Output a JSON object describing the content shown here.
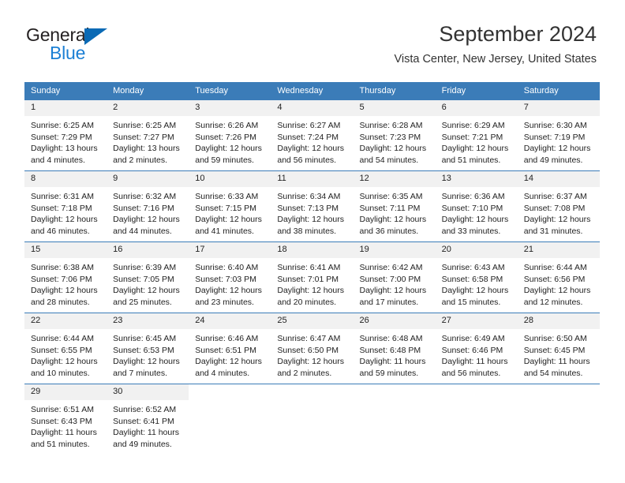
{
  "brand": {
    "line1": "General",
    "line2": "Blue",
    "triangle_color": "#0a6ab5",
    "line2_color": "#1b7fd4"
  },
  "header": {
    "title": "September 2024",
    "subtitle": "Vista Center, New Jersey, United States",
    "accent_color": "#3b7cb8",
    "daynum_background": "#f1f1f1"
  },
  "weekday_headers": [
    "Sunday",
    "Monday",
    "Tuesday",
    "Wednesday",
    "Thursday",
    "Friday",
    "Saturday"
  ],
  "weeks": [
    [
      {
        "day": "1",
        "sunrise": "Sunrise: 6:25 AM",
        "sunset": "Sunset: 7:29 PM",
        "daylight1": "Daylight: 13 hours",
        "daylight2": "and 4 minutes."
      },
      {
        "day": "2",
        "sunrise": "Sunrise: 6:25 AM",
        "sunset": "Sunset: 7:27 PM",
        "daylight1": "Daylight: 13 hours",
        "daylight2": "and 2 minutes."
      },
      {
        "day": "3",
        "sunrise": "Sunrise: 6:26 AM",
        "sunset": "Sunset: 7:26 PM",
        "daylight1": "Daylight: 12 hours",
        "daylight2": "and 59 minutes."
      },
      {
        "day": "4",
        "sunrise": "Sunrise: 6:27 AM",
        "sunset": "Sunset: 7:24 PM",
        "daylight1": "Daylight: 12 hours",
        "daylight2": "and 56 minutes."
      },
      {
        "day": "5",
        "sunrise": "Sunrise: 6:28 AM",
        "sunset": "Sunset: 7:23 PM",
        "daylight1": "Daylight: 12 hours",
        "daylight2": "and 54 minutes."
      },
      {
        "day": "6",
        "sunrise": "Sunrise: 6:29 AM",
        "sunset": "Sunset: 7:21 PM",
        "daylight1": "Daylight: 12 hours",
        "daylight2": "and 51 minutes."
      },
      {
        "day": "7",
        "sunrise": "Sunrise: 6:30 AM",
        "sunset": "Sunset: 7:19 PM",
        "daylight1": "Daylight: 12 hours",
        "daylight2": "and 49 minutes."
      }
    ],
    [
      {
        "day": "8",
        "sunrise": "Sunrise: 6:31 AM",
        "sunset": "Sunset: 7:18 PM",
        "daylight1": "Daylight: 12 hours",
        "daylight2": "and 46 minutes."
      },
      {
        "day": "9",
        "sunrise": "Sunrise: 6:32 AM",
        "sunset": "Sunset: 7:16 PM",
        "daylight1": "Daylight: 12 hours",
        "daylight2": "and 44 minutes."
      },
      {
        "day": "10",
        "sunrise": "Sunrise: 6:33 AM",
        "sunset": "Sunset: 7:15 PM",
        "daylight1": "Daylight: 12 hours",
        "daylight2": "and 41 minutes."
      },
      {
        "day": "11",
        "sunrise": "Sunrise: 6:34 AM",
        "sunset": "Sunset: 7:13 PM",
        "daylight1": "Daylight: 12 hours",
        "daylight2": "and 38 minutes."
      },
      {
        "day": "12",
        "sunrise": "Sunrise: 6:35 AM",
        "sunset": "Sunset: 7:11 PM",
        "daylight1": "Daylight: 12 hours",
        "daylight2": "and 36 minutes."
      },
      {
        "day": "13",
        "sunrise": "Sunrise: 6:36 AM",
        "sunset": "Sunset: 7:10 PM",
        "daylight1": "Daylight: 12 hours",
        "daylight2": "and 33 minutes."
      },
      {
        "day": "14",
        "sunrise": "Sunrise: 6:37 AM",
        "sunset": "Sunset: 7:08 PM",
        "daylight1": "Daylight: 12 hours",
        "daylight2": "and 31 minutes."
      }
    ],
    [
      {
        "day": "15",
        "sunrise": "Sunrise: 6:38 AM",
        "sunset": "Sunset: 7:06 PM",
        "daylight1": "Daylight: 12 hours",
        "daylight2": "and 28 minutes."
      },
      {
        "day": "16",
        "sunrise": "Sunrise: 6:39 AM",
        "sunset": "Sunset: 7:05 PM",
        "daylight1": "Daylight: 12 hours",
        "daylight2": "and 25 minutes."
      },
      {
        "day": "17",
        "sunrise": "Sunrise: 6:40 AM",
        "sunset": "Sunset: 7:03 PM",
        "daylight1": "Daylight: 12 hours",
        "daylight2": "and 23 minutes."
      },
      {
        "day": "18",
        "sunrise": "Sunrise: 6:41 AM",
        "sunset": "Sunset: 7:01 PM",
        "daylight1": "Daylight: 12 hours",
        "daylight2": "and 20 minutes."
      },
      {
        "day": "19",
        "sunrise": "Sunrise: 6:42 AM",
        "sunset": "Sunset: 7:00 PM",
        "daylight1": "Daylight: 12 hours",
        "daylight2": "and 17 minutes."
      },
      {
        "day": "20",
        "sunrise": "Sunrise: 6:43 AM",
        "sunset": "Sunset: 6:58 PM",
        "daylight1": "Daylight: 12 hours",
        "daylight2": "and 15 minutes."
      },
      {
        "day": "21",
        "sunrise": "Sunrise: 6:44 AM",
        "sunset": "Sunset: 6:56 PM",
        "daylight1": "Daylight: 12 hours",
        "daylight2": "and 12 minutes."
      }
    ],
    [
      {
        "day": "22",
        "sunrise": "Sunrise: 6:44 AM",
        "sunset": "Sunset: 6:55 PM",
        "daylight1": "Daylight: 12 hours",
        "daylight2": "and 10 minutes."
      },
      {
        "day": "23",
        "sunrise": "Sunrise: 6:45 AM",
        "sunset": "Sunset: 6:53 PM",
        "daylight1": "Daylight: 12 hours",
        "daylight2": "and 7 minutes."
      },
      {
        "day": "24",
        "sunrise": "Sunrise: 6:46 AM",
        "sunset": "Sunset: 6:51 PM",
        "daylight1": "Daylight: 12 hours",
        "daylight2": "and 4 minutes."
      },
      {
        "day": "25",
        "sunrise": "Sunrise: 6:47 AM",
        "sunset": "Sunset: 6:50 PM",
        "daylight1": "Daylight: 12 hours",
        "daylight2": "and 2 minutes."
      },
      {
        "day": "26",
        "sunrise": "Sunrise: 6:48 AM",
        "sunset": "Sunset: 6:48 PM",
        "daylight1": "Daylight: 11 hours",
        "daylight2": "and 59 minutes."
      },
      {
        "day": "27",
        "sunrise": "Sunrise: 6:49 AM",
        "sunset": "Sunset: 6:46 PM",
        "daylight1": "Daylight: 11 hours",
        "daylight2": "and 56 minutes."
      },
      {
        "day": "28",
        "sunrise": "Sunrise: 6:50 AM",
        "sunset": "Sunset: 6:45 PM",
        "daylight1": "Daylight: 11 hours",
        "daylight2": "and 54 minutes."
      }
    ],
    [
      {
        "day": "29",
        "sunrise": "Sunrise: 6:51 AM",
        "sunset": "Sunset: 6:43 PM",
        "daylight1": "Daylight: 11 hours",
        "daylight2": "and 51 minutes."
      },
      {
        "day": "30",
        "sunrise": "Sunrise: 6:52 AM",
        "sunset": "Sunset: 6:41 PM",
        "daylight1": "Daylight: 11 hours",
        "daylight2": "and 49 minutes."
      },
      {
        "day": "",
        "sunrise": "",
        "sunset": "",
        "daylight1": "",
        "daylight2": ""
      },
      {
        "day": "",
        "sunrise": "",
        "sunset": "",
        "daylight1": "",
        "daylight2": ""
      },
      {
        "day": "",
        "sunrise": "",
        "sunset": "",
        "daylight1": "",
        "daylight2": ""
      },
      {
        "day": "",
        "sunrise": "",
        "sunset": "",
        "daylight1": "",
        "daylight2": ""
      },
      {
        "day": "",
        "sunrise": "",
        "sunset": "",
        "daylight1": "",
        "daylight2": ""
      }
    ]
  ]
}
